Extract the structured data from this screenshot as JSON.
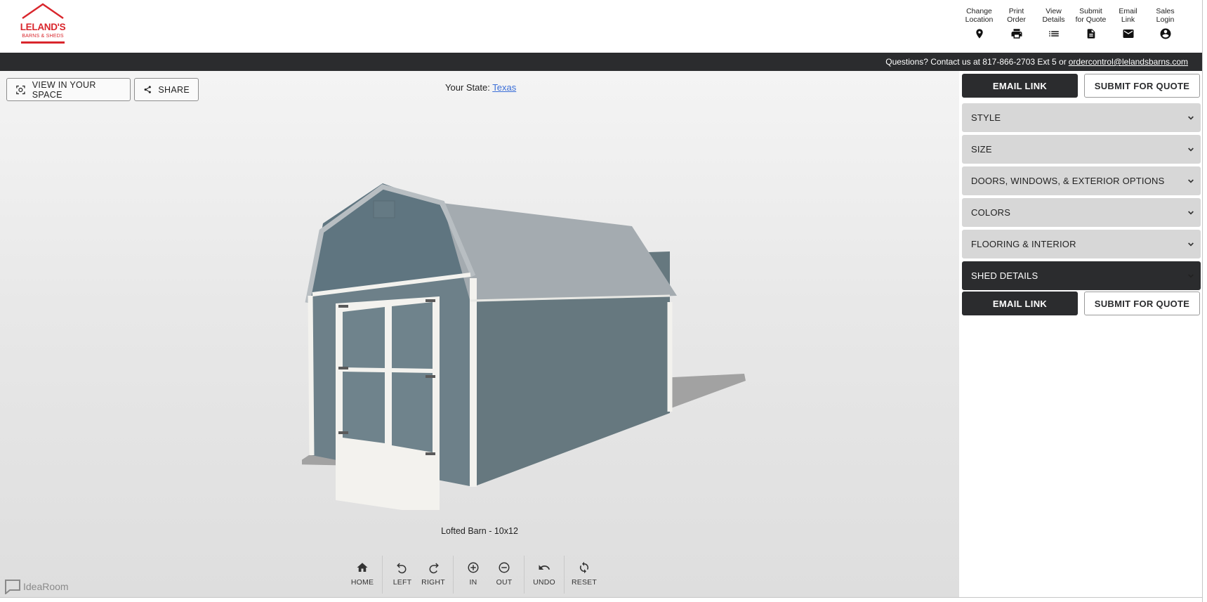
{
  "brand": {
    "name": "LELAND'S",
    "tagline": "BARNS & SHEDS",
    "color": "#d9262c"
  },
  "top_actions": [
    {
      "label": "Change\nLocation",
      "icon": "location-pin-icon"
    },
    {
      "label": "Print\nOrder",
      "icon": "printer-icon"
    },
    {
      "label": "View\nDetails",
      "icon": "list-icon"
    },
    {
      "label": "Submit\nfor Quote",
      "icon": "document-icon"
    },
    {
      "label": "Email\nLink",
      "icon": "envelope-icon"
    },
    {
      "label": "Sales\nLogin",
      "icon": "account-icon"
    }
  ],
  "contact": {
    "text": "Questions? Contact us at 817-866-2703 Ext 5 or",
    "email": "ordercontrol@lelandsbarns.com"
  },
  "viewer": {
    "view_in_space_label": "VIEW IN YOUR SPACE",
    "share_label": "SHARE",
    "state_label": "Your State:",
    "state_value": "Texas",
    "model_caption": "Lofted Barn - 10x12",
    "controls": [
      {
        "label": "HOME",
        "icon": "home-icon"
      },
      {
        "label": "LEFT",
        "icon": "rotate-left-icon"
      },
      {
        "label": "RIGHT",
        "icon": "rotate-right-icon"
      },
      {
        "label": "IN",
        "icon": "zoom-in-icon"
      },
      {
        "label": "OUT",
        "icon": "zoom-out-icon"
      },
      {
        "label": "UNDO",
        "icon": "undo-icon"
      },
      {
        "label": "RESET",
        "icon": "reset-icon"
      }
    ],
    "watermark": "IdeaRoom"
  },
  "sidebar": {
    "email_link_label": "EMAIL LINK",
    "submit_label": "SUBMIT FOR QUOTE",
    "sections": [
      {
        "label": "STYLE",
        "active": false
      },
      {
        "label": "SIZE",
        "active": false
      },
      {
        "label": "DOORS, WINDOWS, & EXTERIOR OPTIONS",
        "active": false
      },
      {
        "label": "COLORS",
        "active": false
      },
      {
        "label": "FLOORING & INTERIOR",
        "active": false
      },
      {
        "label": "SHED DETAILS",
        "active": true
      }
    ]
  },
  "colors": {
    "dark": "#2b2c2e",
    "accordion_bg": "#d7d7d7",
    "link": "#3b6fd8",
    "shed_siding": "#6f8390",
    "shed_roof": "#a4abb0",
    "shed_trim": "#f3f2ee"
  }
}
